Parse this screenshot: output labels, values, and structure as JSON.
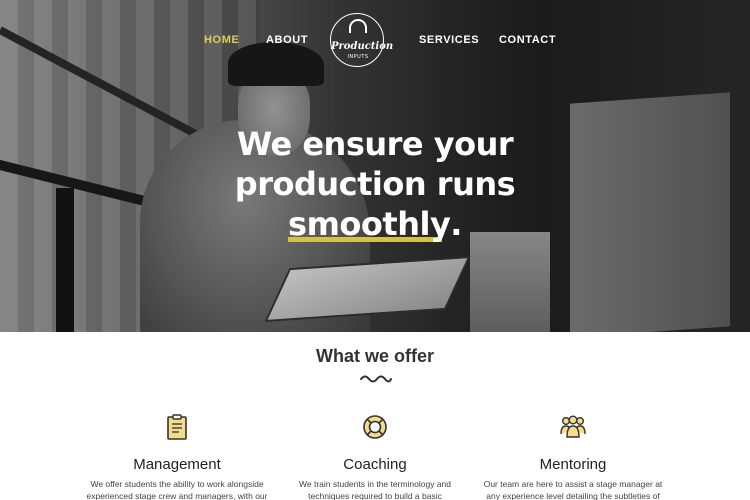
{
  "nav": {
    "home": "HOME",
    "about": "ABOUT",
    "services": "SERVICES",
    "contact": "CONTACT",
    "active_color": "#e3cb57"
  },
  "logo": {
    "word": "Production",
    "sub": "INPUTS",
    "icon": "headset-icon"
  },
  "hero": {
    "line1": "We ensure your",
    "line2": "production runs",
    "line3_word": "smoothly",
    "line3_punct": ".",
    "accent_color": "#d5c04a"
  },
  "offer": {
    "title": "What we offer",
    "features": [
      {
        "icon": "clipboard-icon",
        "title": "Management",
        "text": "We offer students the ability to work alongside experienced stage crew and managers, with our"
      },
      {
        "icon": "lifebuoy-icon",
        "title": "Coaching",
        "text": "We train students in the terminology and techniques required to build a basic"
      },
      {
        "icon": "team-icon",
        "title": "Mentoring",
        "text": "Our team are here to assist a stage manager at any experience level detailing the subtleties of"
      }
    ]
  }
}
